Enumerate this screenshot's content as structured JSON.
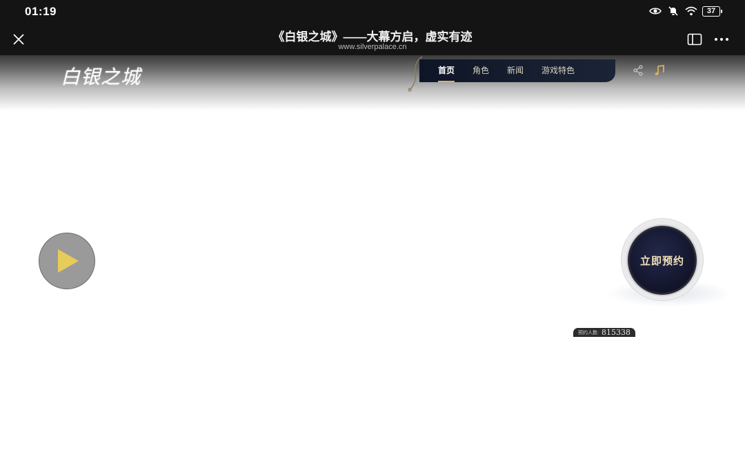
{
  "status_bar": {
    "time": "01:19",
    "battery": "37",
    "icons": [
      "eye-icon",
      "mute-bell-icon",
      "wifi-icon",
      "battery-icon"
    ]
  },
  "browser": {
    "title": "《白银之城》——大幕方启，虚实有迹",
    "url": "www.silverpalace.cn",
    "close_icon": "close-icon",
    "tabs_icon": "tabs-icon",
    "more_icon": "more-icon"
  },
  "site": {
    "logo": "白银之城",
    "nav": [
      {
        "label": "首页",
        "active": true
      },
      {
        "label": "角色",
        "active": false
      },
      {
        "label": "新闻",
        "active": false
      },
      {
        "label": "游戏特色",
        "active": false
      }
    ],
    "share_icon": "share-icon",
    "music_icon": "music-note-icon",
    "play_icon": "play-icon",
    "reserve_label": "立即预约",
    "reserve_count_label": "预约人数:",
    "reserve_count": "815338",
    "colors": {
      "accent_gold": "#d9b25a",
      "nav_bg": "#0e1527",
      "reserve_text": "#f0e2b8",
      "play_triangle": "#e8cc5a"
    }
  }
}
